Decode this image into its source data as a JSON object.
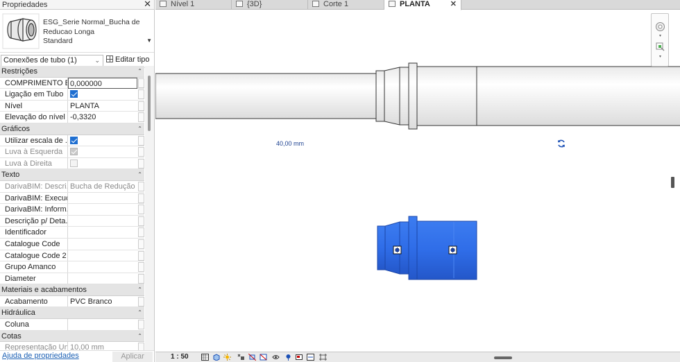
{
  "properties": {
    "title": "Propriedades",
    "type_name": [
      "ESG_Serie Normal_Bucha de",
      "Reducao Longa",
      "Standard"
    ],
    "filter": "Conexões de tubo (1)",
    "edit_type": "Editar tipo",
    "sections": [
      {
        "name": "Restrições",
        "rows": [
          {
            "label": "COMPRIMENTO E...",
            "value": "0,000000",
            "kind": "edit"
          },
          {
            "label": "Ligação em Tubo",
            "kind": "check",
            "checked": "on"
          },
          {
            "label": "Nível",
            "value": "PLANTA"
          },
          {
            "label": "Elevação do nível",
            "value": "-0,3320"
          }
        ]
      },
      {
        "name": "Gráficos",
        "rows": [
          {
            "label": "Utilizar escala de ...",
            "kind": "check",
            "checked": "on"
          },
          {
            "label": "Luva à Esquerda",
            "kind": "check",
            "checked": "grey",
            "dim": true
          },
          {
            "label": "Luva à Direita",
            "kind": "check",
            "checked": "off",
            "dim": true
          }
        ]
      },
      {
        "name": "Texto",
        "rows": [
          {
            "label": "DarivaBIM: Descri...",
            "value": "Bucha de Redução ...",
            "dim": true
          },
          {
            "label": "DarivaBIM: Execuç...",
            "value": ""
          },
          {
            "label": "DarivaBIM: Inform...",
            "value": ""
          },
          {
            "label": "Descrição p/ Deta...",
            "value": ""
          },
          {
            "label": "Identificador",
            "value": ""
          },
          {
            "label": "Catalogue Code",
            "value": ""
          },
          {
            "label": "Catalogue Code 2",
            "value": ""
          },
          {
            "label": "Grupo  Amanco",
            "value": ""
          },
          {
            "label": "Diameter",
            "value": ""
          }
        ]
      },
      {
        "name": "Materiais e acabamentos",
        "rows": [
          {
            "label": "Acabamento",
            "value": "PVC Branco"
          }
        ]
      },
      {
        "name": "Hidráulica",
        "rows": [
          {
            "label": "Coluna",
            "value": ""
          }
        ]
      },
      {
        "name": "Cotas",
        "rows": [
          {
            "label": "Representação Un...",
            "value": "10,00 mm",
            "dim": true
          }
        ]
      }
    ],
    "help_link": "Ajuda de propriedades",
    "apply": "Aplicar"
  },
  "tabs": [
    {
      "label": "Nível 1",
      "active": false
    },
    {
      "label": "{3D}",
      "active": false
    },
    {
      "label": "Corte 1",
      "active": false
    },
    {
      "label": "PLANTA",
      "active": true
    }
  ],
  "canvas": {
    "dimension_label": "40,00 mm",
    "selection_color": "#2f6de8",
    "pipe_fill": "#f7f7f7"
  },
  "status": {
    "scale": "1 : 50"
  },
  "icons": [
    "close-icon",
    "edit-type-icon",
    "rotate-icon",
    "steering-wheel-icon",
    "zoom-icon"
  ]
}
